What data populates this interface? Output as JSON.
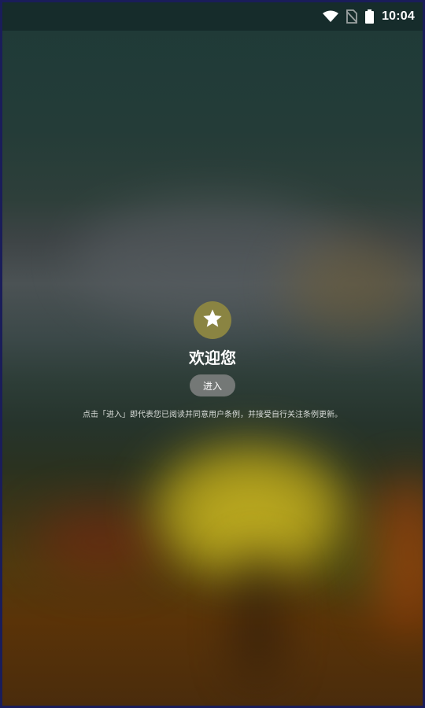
{
  "status_bar": {
    "time": "10:04",
    "icons": [
      "wifi-icon",
      "no-sim-icon",
      "battery-icon"
    ]
  },
  "welcome": {
    "logo_icon": "star-icon",
    "title": "欢迎您",
    "enter_label": "进入",
    "terms_text": "点击「进入」即代表您已阅读并同意用户条例，并接受自行关注条例更新。"
  },
  "colors": {
    "logo_bg": "#8a8442",
    "button_bg": "#8c8c8c",
    "text": "#ffffff"
  }
}
